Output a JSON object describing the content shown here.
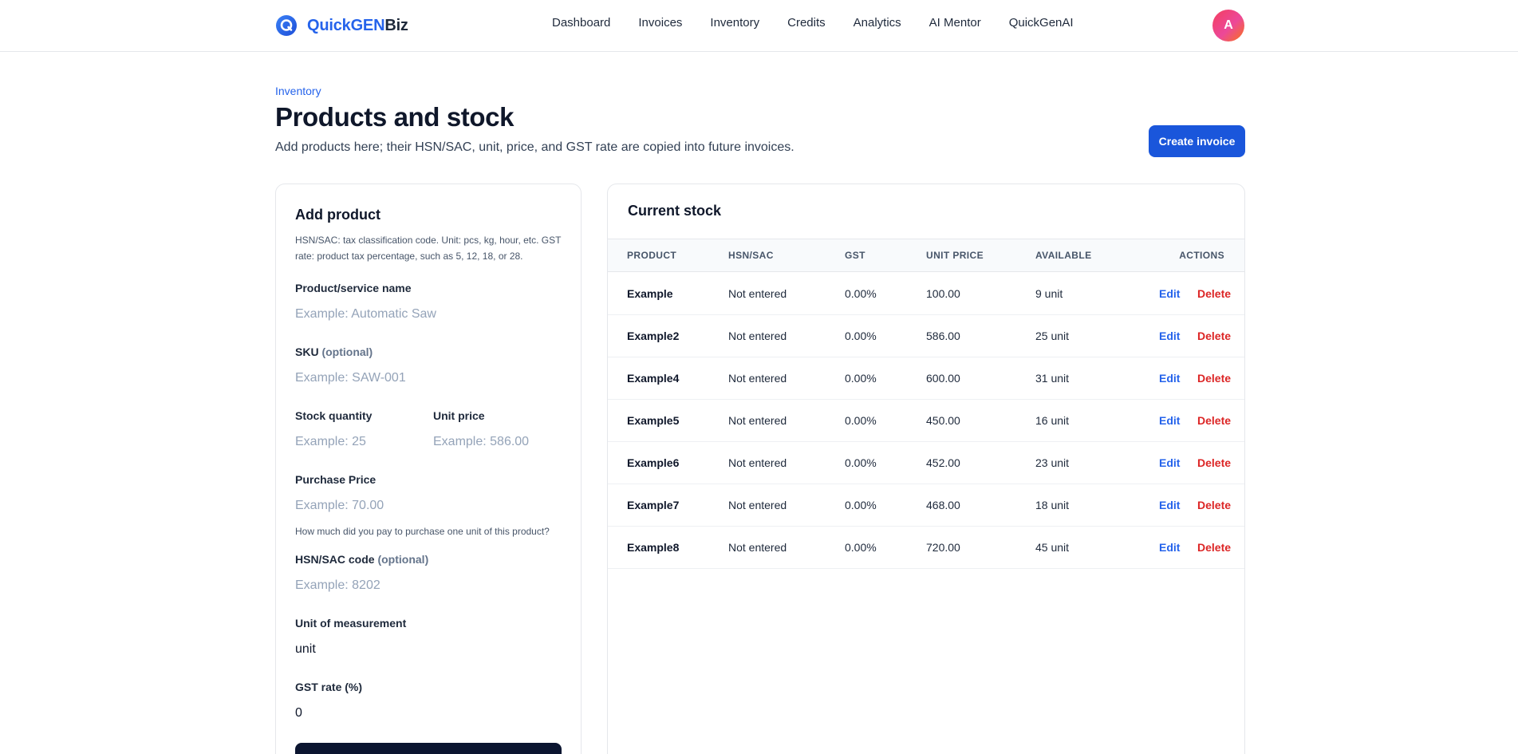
{
  "brand": {
    "name_part1": "QuickGEN",
    "name_part2": "Biz",
    "accent": "#2563eb"
  },
  "nav": [
    {
      "label": "Dashboard",
      "name": "nav-dashboard"
    },
    {
      "label": "Invoices",
      "name": "nav-invoices"
    },
    {
      "label": "Inventory",
      "name": "nav-inventory"
    },
    {
      "label": "Credits",
      "name": "nav-credits"
    },
    {
      "label": "Analytics",
      "name": "nav-analytics"
    },
    {
      "label": "AI Mentor",
      "name": "nav-ai-mentor"
    },
    {
      "label": "QuickGenAI",
      "name": "nav-quickgenai"
    }
  ],
  "user": {
    "avatar_initial": "A"
  },
  "header": {
    "breadcrumb": "Inventory",
    "title": "Products and stock",
    "subtitle": "Add products here; their HSN/SAC, unit, price, and GST rate are copied into future invoices.",
    "create_invoice_label": "Create invoice"
  },
  "add_product": {
    "title": "Add product",
    "help": "HSN/SAC: tax classification code. Unit: pcs, kg, hour, etc. GST rate: product tax percentage, such as 5, 12, 18, or 28.",
    "optional_tag": "(optional)",
    "fields": {
      "name": {
        "label": "Product/service name",
        "placeholder": "Example: Automatic Saw",
        "value": ""
      },
      "sku": {
        "label": "SKU",
        "placeholder": "Example: SAW-001",
        "value": ""
      },
      "stock": {
        "label": "Stock quantity",
        "placeholder": "Example: 25",
        "value": ""
      },
      "unit_price": {
        "label": "Unit price",
        "placeholder": "Example: 586.00",
        "value": ""
      },
      "purchase_price": {
        "label": "Purchase Price",
        "placeholder": "Example: 70.00",
        "value": "",
        "hint": "How much did you pay to purchase one unit of this product?"
      },
      "hsn": {
        "label": "HSN/SAC code",
        "placeholder": "Example: 8202",
        "value": ""
      },
      "unit": {
        "label": "Unit of measurement",
        "value": "unit"
      },
      "gst": {
        "label": "GST rate (%)",
        "value": "0"
      }
    }
  },
  "stock": {
    "title": "Current stock",
    "columns": [
      "PRODUCT",
      "HSN/SAC",
      "GST",
      "UNIT PRICE",
      "AVAILABLE",
      "ACTIONS"
    ],
    "edit_label": "Edit",
    "delete_label": "Delete",
    "rows": [
      {
        "product": "Example",
        "hsn": "Not entered",
        "gst": "0.00%",
        "price": "100.00",
        "available": "9 unit"
      },
      {
        "product": "Example2",
        "hsn": "Not entered",
        "gst": "0.00%",
        "price": "586.00",
        "available": "25 unit"
      },
      {
        "product": "Example4",
        "hsn": "Not entered",
        "gst": "0.00%",
        "price": "600.00",
        "available": "31 unit"
      },
      {
        "product": "Example5",
        "hsn": "Not entered",
        "gst": "0.00%",
        "price": "450.00",
        "available": "16 unit"
      },
      {
        "product": "Example6",
        "hsn": "Not entered",
        "gst": "0.00%",
        "price": "452.00",
        "available": "23 unit"
      },
      {
        "product": "Example7",
        "hsn": "Not entered",
        "gst": "0.00%",
        "price": "468.00",
        "available": "18 unit"
      },
      {
        "product": "Example8",
        "hsn": "Not entered",
        "gst": "0.00%",
        "price": "720.00",
        "available": "45 unit"
      }
    ]
  }
}
